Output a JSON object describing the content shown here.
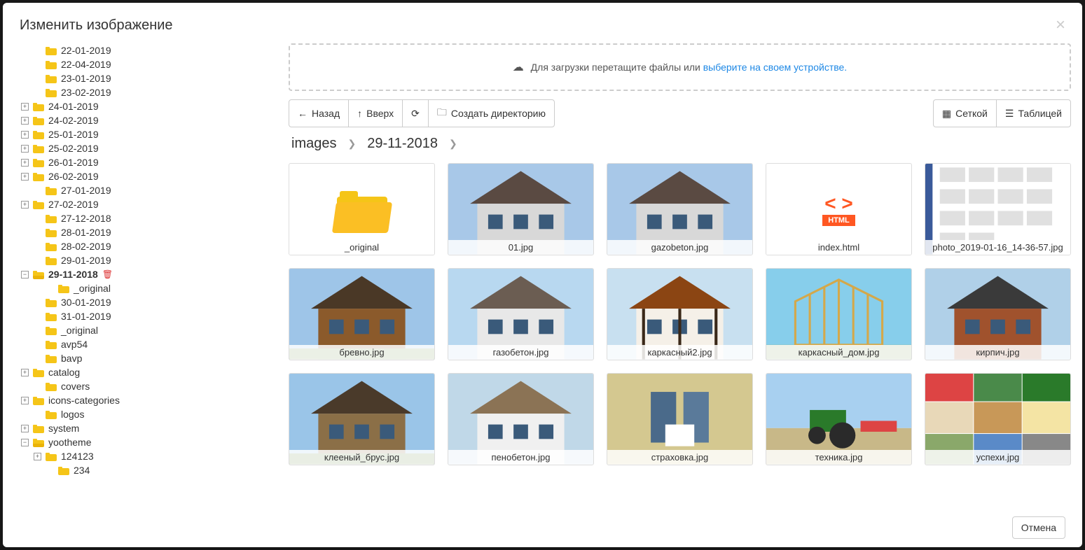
{
  "modal": {
    "title": "Изменить изображение",
    "close_label": "×"
  },
  "tree": [
    {
      "type": "item",
      "indent": 1,
      "label": "22-01-2019"
    },
    {
      "type": "item",
      "indent": 1,
      "label": "22-04-2019"
    },
    {
      "type": "item",
      "indent": 1,
      "label": "23-01-2019"
    },
    {
      "type": "item",
      "indent": 1,
      "label": "23-02-2019"
    },
    {
      "type": "expandable",
      "indent": 0,
      "toggle": "+",
      "label": "24-01-2019"
    },
    {
      "type": "expandable",
      "indent": 0,
      "toggle": "+",
      "label": "24-02-2019"
    },
    {
      "type": "expandable",
      "indent": 0,
      "toggle": "+",
      "label": "25-01-2019"
    },
    {
      "type": "expandable",
      "indent": 0,
      "toggle": "+",
      "label": "25-02-2019"
    },
    {
      "type": "expandable",
      "indent": 0,
      "toggle": "+",
      "label": "26-01-2019"
    },
    {
      "type": "expandable",
      "indent": 0,
      "toggle": "+",
      "label": "26-02-2019"
    },
    {
      "type": "item",
      "indent": 1,
      "label": "27-01-2019"
    },
    {
      "type": "expandable",
      "indent": 0,
      "toggle": "+",
      "label": "27-02-2019"
    },
    {
      "type": "item",
      "indent": 1,
      "label": "27-12-2018"
    },
    {
      "type": "item",
      "indent": 1,
      "label": "28-01-2019"
    },
    {
      "type": "item",
      "indent": 1,
      "label": "28-02-2019"
    },
    {
      "type": "item",
      "indent": 1,
      "label": "29-01-2019"
    },
    {
      "type": "expandable",
      "indent": 0,
      "toggle": "−",
      "label": "29-11-2018",
      "active": true,
      "open": true,
      "delete": true
    },
    {
      "type": "item",
      "indent": 2,
      "label": "_original"
    },
    {
      "type": "item",
      "indent": 1,
      "label": "30-01-2019"
    },
    {
      "type": "item",
      "indent": 1,
      "label": "31-01-2019"
    },
    {
      "type": "item",
      "indent": 1,
      "label": "_original"
    },
    {
      "type": "item",
      "indent": 1,
      "label": "avp54"
    },
    {
      "type": "item",
      "indent": 1,
      "label": "bavp"
    },
    {
      "type": "expandable",
      "indent": 0,
      "toggle": "+",
      "label": "catalog"
    },
    {
      "type": "item",
      "indent": 1,
      "label": "covers"
    },
    {
      "type": "expandable",
      "indent": 0,
      "toggle": "+",
      "label": "icons-categories"
    },
    {
      "type": "item",
      "indent": 1,
      "label": "logos"
    },
    {
      "type": "expandable",
      "indent": 0,
      "toggle": "+",
      "label": "system"
    },
    {
      "type": "expandable",
      "indent": 0,
      "toggle": "−",
      "label": "yootheme",
      "open": true
    },
    {
      "type": "expandable",
      "indent": 1,
      "toggle": "+",
      "label": "124123"
    },
    {
      "type": "item",
      "indent": 2,
      "label": "234"
    }
  ],
  "dropzone": {
    "text": "Для загрузки перетащите файлы или ",
    "link": "выберите на своем устройстве."
  },
  "toolbar": {
    "back": "Назад",
    "up": "Вверх",
    "refresh": "",
    "create_dir": "Создать директорию",
    "grid": "Сеткой",
    "table": "Таблицей"
  },
  "breadcrumb": [
    "images",
    "29-11-2018"
  ],
  "files": [
    {
      "name": "_original",
      "type": "folder"
    },
    {
      "name": "01.jpg",
      "type": "image",
      "bg": "house-gray-1"
    },
    {
      "name": "gazobeton.jpg",
      "type": "image",
      "bg": "house-gray-1"
    },
    {
      "name": "index.html",
      "type": "html"
    },
    {
      "name": "photo_2019-01-16_14-36-57.jpg",
      "type": "image",
      "bg": "screenshot"
    },
    {
      "name": "бревно.jpg",
      "type": "image",
      "bg": "house-log"
    },
    {
      "name": "газобетон.jpg",
      "type": "image",
      "bg": "house-gray-2"
    },
    {
      "name": "каркасный2.jpg",
      "type": "image",
      "bg": "house-tudor"
    },
    {
      "name": "каркасный_дом.jpg",
      "type": "image",
      "bg": "house-frame"
    },
    {
      "name": "кирпич.jpg",
      "type": "image",
      "bg": "house-brick"
    },
    {
      "name": "клееный_брус.jpg",
      "type": "image",
      "bg": "house-timber"
    },
    {
      "name": "пенобетон.jpg",
      "type": "image",
      "bg": "house-foam"
    },
    {
      "name": "страховка.jpg",
      "type": "image",
      "bg": "insurance"
    },
    {
      "name": "техника.jpg",
      "type": "image",
      "bg": "tractor"
    },
    {
      "name": "успехи.jpg",
      "type": "image",
      "bg": "collage"
    }
  ],
  "footer": {
    "cancel": "Отмена"
  }
}
